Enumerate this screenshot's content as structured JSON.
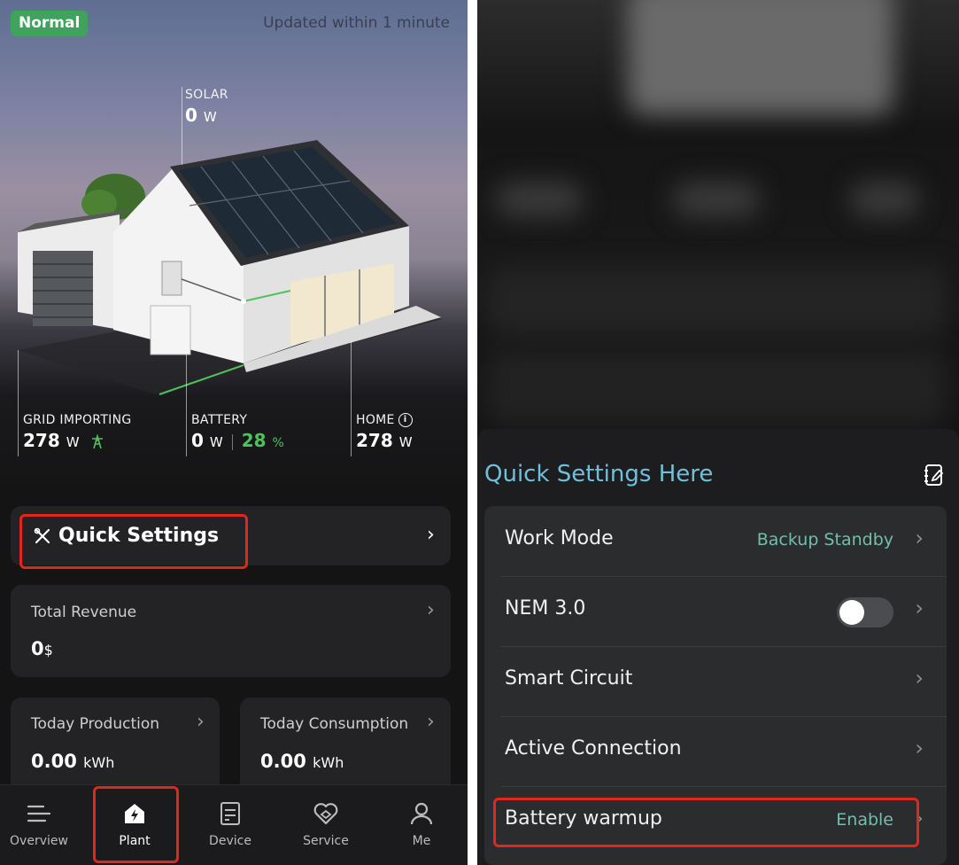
{
  "left": {
    "status_badge": "Normal",
    "updated_text": "Updated  within 1 minute",
    "solar": {
      "label": "SOLAR",
      "value": "0",
      "unit": "W"
    },
    "grid": {
      "label": "GRID IMPORTING",
      "value": "278",
      "unit": "W"
    },
    "battery": {
      "label": "BATTERY",
      "value": "0",
      "unit": "W",
      "soc": "28",
      "soc_unit": "%"
    },
    "home": {
      "label": "HOME",
      "value": "278",
      "unit": "W"
    },
    "quick_settings": {
      "label": "Quick Settings"
    },
    "total_revenue": {
      "label": "Total Revenue",
      "value": "0",
      "unit": "$"
    },
    "today_production": {
      "label": "Today Production",
      "value": "0.00",
      "unit": "kWh"
    },
    "today_consumption": {
      "label": "Today Consumption",
      "value": "0.00",
      "unit": "kWh"
    },
    "tabs": [
      {
        "label": "Overview",
        "icon": "menu-lines-icon"
      },
      {
        "label": "Plant",
        "icon": "house-bolt-icon",
        "active": true
      },
      {
        "label": "Device",
        "icon": "device-icon"
      },
      {
        "label": "Service",
        "icon": "heart-wrench-icon"
      },
      {
        "label": "Me",
        "icon": "person-icon"
      }
    ]
  },
  "right": {
    "title": "Quick Settings Here",
    "rows": [
      {
        "label": "Work Mode",
        "value": "Backup Standby"
      },
      {
        "label": "NEM 3.0",
        "toggle": false
      },
      {
        "label": "Smart Circuit",
        "value": ""
      },
      {
        "label": "Active Connection",
        "value": ""
      },
      {
        "label": "Battery warmup",
        "value": "Enable"
      }
    ]
  },
  "colors": {
    "accent_green": "#4fc25f",
    "badge_green": "#3fa35d",
    "title_blue": "#6fc0da",
    "value_teal": "#6fbfa9",
    "highlight_red": "#e3261c"
  }
}
